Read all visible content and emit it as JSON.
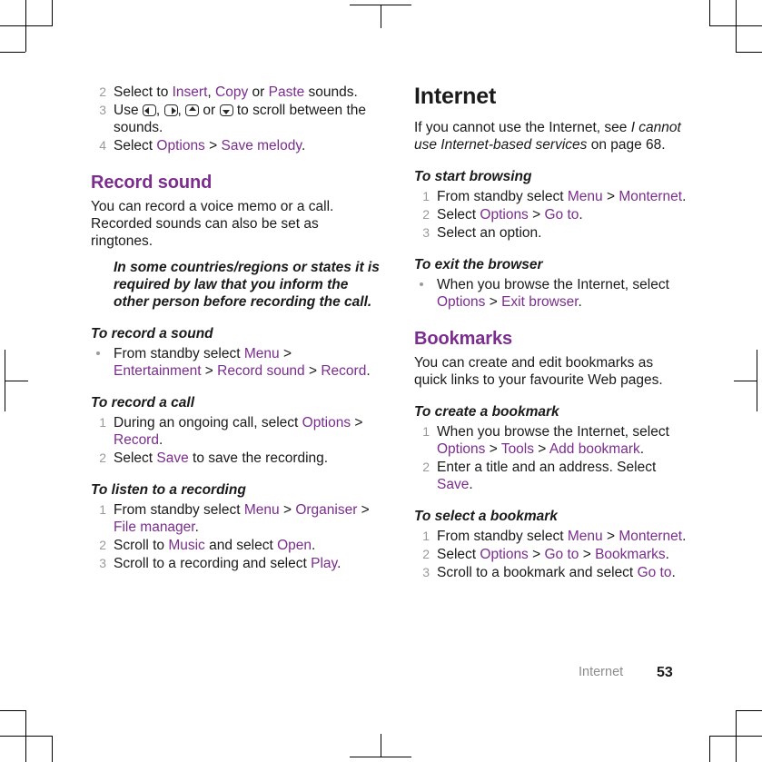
{
  "footer": {
    "chapter": "Internet",
    "page_number": "53"
  },
  "colors": {
    "ui_term": "#7B2D8E",
    "heading_purple": "#7B2D8E",
    "body_text": "#1a1a1a",
    "marker_gray": "#9a9a9a",
    "footer_gray": "#8c8c8c"
  },
  "left_column": {
    "continued_steps": [
      {
        "num": "2",
        "parts": [
          {
            "t": "Select to ",
            "s": "plain"
          },
          {
            "t": "Insert",
            "s": "ui"
          },
          {
            "t": ", ",
            "s": "plain"
          },
          {
            "t": "Copy",
            "s": "ui"
          },
          {
            "t": " or ",
            "s": "plain"
          },
          {
            "t": "Paste",
            "s": "ui"
          },
          {
            "t": " sounds.",
            "s": "plain"
          }
        ]
      },
      {
        "num": "3",
        "parts": [
          {
            "t": "Use ",
            "s": "plain"
          },
          {
            "t": "",
            "s": "navkey-left"
          },
          {
            "t": ", ",
            "s": "plain"
          },
          {
            "t": "",
            "s": "navkey-right"
          },
          {
            "t": ", ",
            "s": "plain"
          },
          {
            "t": "",
            "s": "navkey-up"
          },
          {
            "t": " or ",
            "s": "plain"
          },
          {
            "t": "",
            "s": "navkey-down"
          },
          {
            "t": " to scroll between the sounds.",
            "s": "plain"
          }
        ]
      },
      {
        "num": "4",
        "parts": [
          {
            "t": "Select ",
            "s": "plain"
          },
          {
            "t": "Options",
            "s": "ui"
          },
          {
            "t": " > ",
            "s": "plain"
          },
          {
            "t": "Save melody",
            "s": "ui"
          },
          {
            "t": ".",
            "s": "plain"
          }
        ]
      }
    ],
    "section_title": "Record sound",
    "intro": "You can record a voice memo or a call. Recorded sounds can also be set as ringtones.",
    "note": "In some countries/regions or states it is required by law that you inform the other person before recording the call.",
    "procedures": [
      {
        "heading": "To record a sound",
        "list_type": "bullet",
        "steps": [
          {
            "num": "",
            "parts": [
              {
                "t": "From standby select ",
                "s": "plain"
              },
              {
                "t": "Menu",
                "s": "ui"
              },
              {
                "t": " > ",
                "s": "plain"
              },
              {
                "t": "Entertainment",
                "s": "ui"
              },
              {
                "t": " > ",
                "s": "plain"
              },
              {
                "t": "Record sound",
                "s": "ui"
              },
              {
                "t": " > ",
                "s": "plain"
              },
              {
                "t": "Record",
                "s": "ui"
              },
              {
                "t": ".",
                "s": "plain"
              }
            ]
          }
        ]
      },
      {
        "heading": "To record a call",
        "list_type": "number",
        "steps": [
          {
            "num": "1",
            "parts": [
              {
                "t": "During an ongoing call, select ",
                "s": "plain"
              },
              {
                "t": "Options",
                "s": "ui"
              },
              {
                "t": " > ",
                "s": "plain"
              },
              {
                "t": "Record",
                "s": "ui"
              },
              {
                "t": ".",
                "s": "plain"
              }
            ]
          },
          {
            "num": "2",
            "parts": [
              {
                "t": "Select ",
                "s": "plain"
              },
              {
                "t": "Save",
                "s": "ui"
              },
              {
                "t": " to save the recording.",
                "s": "plain"
              }
            ]
          }
        ]
      },
      {
        "heading": "To listen to a recording",
        "list_type": "number",
        "steps": [
          {
            "num": "1",
            "parts": [
              {
                "t": "From standby select ",
                "s": "plain"
              },
              {
                "t": "Menu",
                "s": "ui"
              },
              {
                "t": " > ",
                "s": "plain"
              },
              {
                "t": "Organiser",
                "s": "ui"
              },
              {
                "t": " > ",
                "s": "plain"
              },
              {
                "t": "File manager",
                "s": "ui"
              },
              {
                "t": ".",
                "s": "plain"
              }
            ]
          },
          {
            "num": "2",
            "parts": [
              {
                "t": "Scroll to ",
                "s": "plain"
              },
              {
                "t": "Music",
                "s": "ui"
              },
              {
                "t": " and select ",
                "s": "plain"
              },
              {
                "t": "Open",
                "s": "ui"
              },
              {
                "t": ".",
                "s": "plain"
              }
            ]
          },
          {
            "num": "3",
            "parts": [
              {
                "t": "Scroll to a recording and select ",
                "s": "plain"
              },
              {
                "t": "Play",
                "s": "ui"
              },
              {
                "t": ".",
                "s": "plain"
              }
            ]
          }
        ]
      }
    ]
  },
  "right_column": {
    "chapter_title": "Internet",
    "intro_parts": [
      {
        "t": "If you cannot use the Internet, see ",
        "s": "plain"
      },
      {
        "t": "I cannot use Internet-based services",
        "s": "italic"
      },
      {
        "t": " on page 68.",
        "s": "plain"
      }
    ],
    "sections": [
      {
        "type": "procedure",
        "heading": "To start browsing",
        "list_type": "number",
        "steps": [
          {
            "num": "1",
            "parts": [
              {
                "t": "From standby select ",
                "s": "plain"
              },
              {
                "t": "Menu",
                "s": "ui"
              },
              {
                "t": " > ",
                "s": "plain"
              },
              {
                "t": "Monternet",
                "s": "ui"
              },
              {
                "t": ".",
                "s": "plain"
              }
            ]
          },
          {
            "num": "2",
            "parts": [
              {
                "t": "Select ",
                "s": "plain"
              },
              {
                "t": "Options",
                "s": "ui"
              },
              {
                "t": " > ",
                "s": "plain"
              },
              {
                "t": "Go to",
                "s": "ui"
              },
              {
                "t": ".",
                "s": "plain"
              }
            ]
          },
          {
            "num": "3",
            "parts": [
              {
                "t": "Select an option.",
                "s": "plain"
              }
            ]
          }
        ]
      },
      {
        "type": "procedure",
        "heading": "To exit the browser",
        "list_type": "bullet",
        "steps": [
          {
            "num": "",
            "parts": [
              {
                "t": "When you browse the Internet, select ",
                "s": "plain"
              },
              {
                "t": "Options",
                "s": "ui"
              },
              {
                "t": " > ",
                "s": "plain"
              },
              {
                "t": "Exit browser",
                "s": "ui"
              },
              {
                "t": ".",
                "s": "plain"
              }
            ]
          }
        ]
      },
      {
        "type": "section",
        "section_title": "Bookmarks",
        "intro": "You can create and edit bookmarks as quick links to your favourite Web pages."
      },
      {
        "type": "procedure",
        "heading": "To create a bookmark",
        "list_type": "number",
        "steps": [
          {
            "num": "1",
            "parts": [
              {
                "t": "When you browse the Internet, select ",
                "s": "plain"
              },
              {
                "t": "Options",
                "s": "ui"
              },
              {
                "t": " > ",
                "s": "plain"
              },
              {
                "t": "Tools",
                "s": "ui"
              },
              {
                "t": " > ",
                "s": "plain"
              },
              {
                "t": "Add bookmark",
                "s": "ui"
              },
              {
                "t": ".",
                "s": "plain"
              }
            ]
          },
          {
            "num": "2",
            "parts": [
              {
                "t": "Enter a title and an address. Select ",
                "s": "plain"
              },
              {
                "t": "Save",
                "s": "ui"
              },
              {
                "t": ".",
                "s": "plain"
              }
            ]
          }
        ]
      },
      {
        "type": "procedure",
        "heading": "To select a bookmark",
        "list_type": "number",
        "steps": [
          {
            "num": "1",
            "parts": [
              {
                "t": "From standby select ",
                "s": "plain"
              },
              {
                "t": "Menu",
                "s": "ui"
              },
              {
                "t": " > ",
                "s": "plain"
              },
              {
                "t": "Monternet",
                "s": "ui"
              },
              {
                "t": ".",
                "s": "plain"
              }
            ]
          },
          {
            "num": "2",
            "parts": [
              {
                "t": "Select ",
                "s": "plain"
              },
              {
                "t": "Options",
                "s": "ui"
              },
              {
                "t": " > ",
                "s": "plain"
              },
              {
                "t": "Go to",
                "s": "ui"
              },
              {
                "t": " > ",
                "s": "plain"
              },
              {
                "t": "Bookmarks",
                "s": "ui"
              },
              {
                "t": ".",
                "s": "plain"
              }
            ]
          },
          {
            "num": "3",
            "parts": [
              {
                "t": "Scroll to a bookmark and select ",
                "s": "plain"
              },
              {
                "t": "Go to",
                "s": "ui"
              },
              {
                "t": ".",
                "s": "plain"
              }
            ]
          }
        ]
      }
    ]
  },
  "crop_marks": {
    "label": "printer-registration-marks",
    "count": 8
  }
}
